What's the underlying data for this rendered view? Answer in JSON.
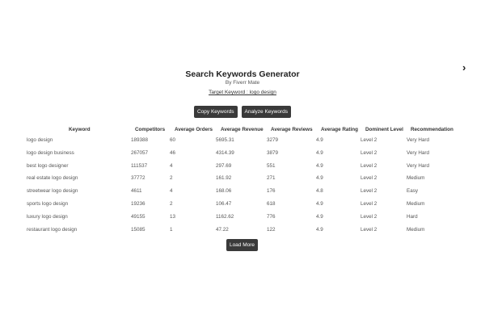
{
  "app": {
    "title": "Search Keywords Generator",
    "subtitle": "By Fiverr Mate",
    "target_keyword": "Target Keyword : logo design"
  },
  "toolbar": {
    "copy_label": "Copy Keywords",
    "analyze_label": "Analyze Keywords"
  },
  "table": {
    "headers": [
      "Keyword",
      "Competitors",
      "Average Orders",
      "Average Revenue",
      "Average Reviews",
      "Average Rating",
      "Dominent Level",
      "Recommendation"
    ],
    "rows": [
      [
        "logo design",
        "189388",
        "60",
        "5695.31",
        "3279",
        "4.9",
        "Level 2",
        "Very Hard"
      ],
      [
        "logo design business",
        "267057",
        "46",
        "4314.39",
        "3879",
        "4.9",
        "Level 2",
        "Very Hard"
      ],
      [
        "best logo designer",
        "111537",
        "4",
        "297.69",
        "551",
        "4.9",
        "Level 2",
        "Very Hard"
      ],
      [
        "real estate logo design",
        "37772",
        "2",
        "161.92",
        "271",
        "4.9",
        "Level 2",
        "Medium"
      ],
      [
        "streetwear logo design",
        "4611",
        "4",
        "168.06",
        "176",
        "4.8",
        "Level 2",
        "Easy"
      ],
      [
        "sports logo design",
        "19236",
        "2",
        "106.47",
        "618",
        "4.9",
        "Level 2",
        "Medium"
      ],
      [
        "luxury logo design",
        "49155",
        "13",
        "1162.62",
        "776",
        "4.9",
        "Level 2",
        "Hard"
      ],
      [
        "restaurant logo design",
        "15085",
        "1",
        "47.22",
        "122",
        "4.9",
        "Level 2",
        "Medium"
      ]
    ]
  },
  "footer": {
    "load_more_label": "Load More"
  },
  "icons": {
    "chevron": "chevron-right-icon"
  }
}
